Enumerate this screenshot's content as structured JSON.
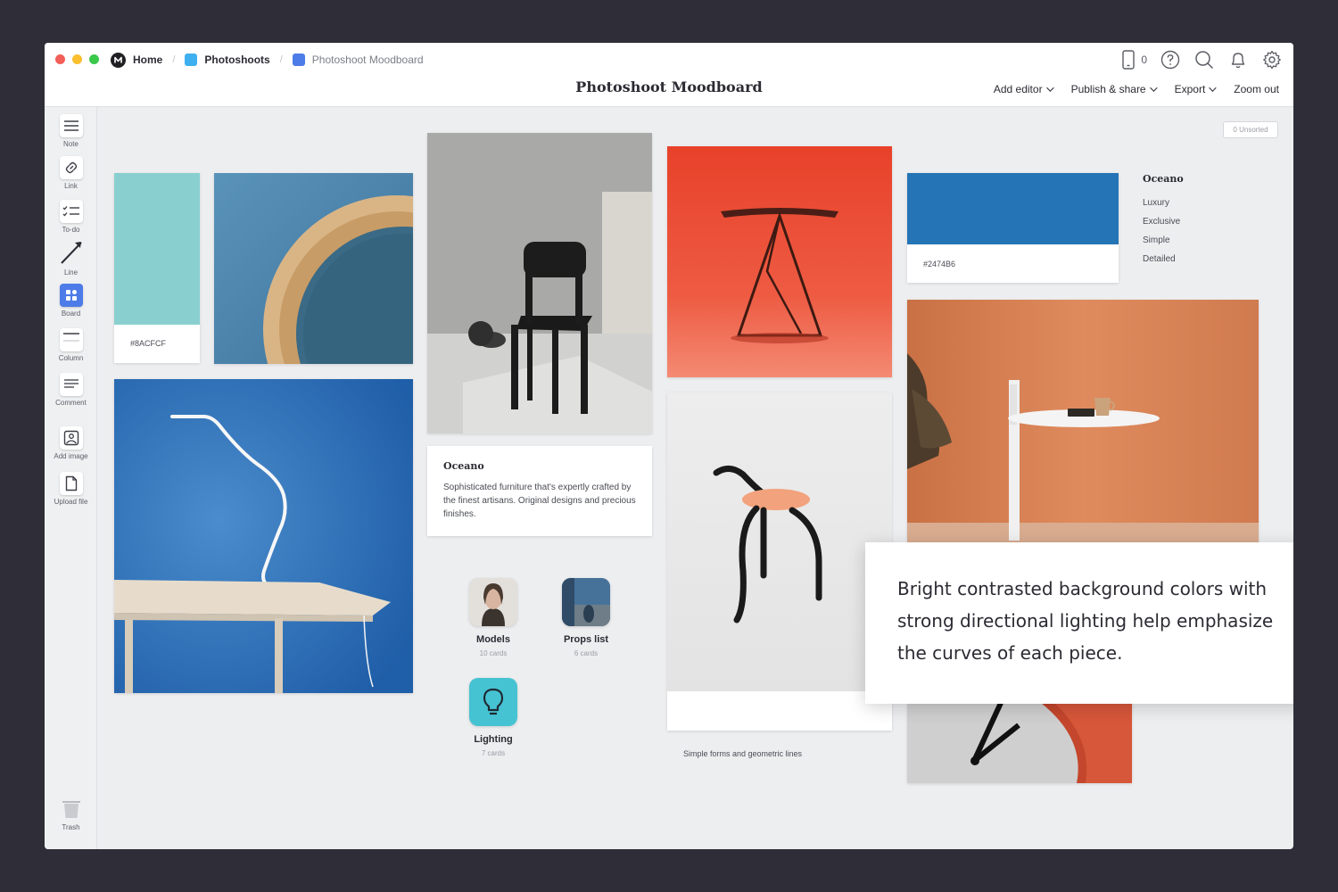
{
  "breadcrumbs": [
    {
      "label": "Home",
      "icon": "milanote-logo-icon"
    },
    {
      "label": "Photoshoots",
      "icon": "board-icon",
      "color": "#3fb0ef"
    },
    {
      "label": "Photoshoot Moodboard",
      "icon": "board-icon",
      "color": "#4d7be8"
    }
  ],
  "title": "Photoshoot Moodboard",
  "header": {
    "device_count": "0",
    "menu": [
      {
        "label": "Add editor",
        "has_dropdown": true
      },
      {
        "label": "Publish & share",
        "has_dropdown": true
      },
      {
        "label": "Export",
        "has_dropdown": true
      },
      {
        "label": "Zoom out",
        "has_dropdown": false
      }
    ]
  },
  "sidebar": {
    "tools": [
      {
        "label": "Note",
        "icon": "note-icon"
      },
      {
        "label": "Link",
        "icon": "link-icon"
      },
      {
        "label": "To-do",
        "icon": "todo-icon"
      },
      {
        "label": "Line",
        "icon": "line-icon"
      },
      {
        "label": "Board",
        "icon": "board-icon"
      },
      {
        "label": "Column",
        "icon": "column-icon"
      },
      {
        "label": "Comment",
        "icon": "comment-icon"
      },
      {
        "label": "Add image",
        "icon": "image-icon"
      },
      {
        "label": "Upload file",
        "icon": "file-icon"
      }
    ],
    "trash_label": "Trash"
  },
  "canvas": {
    "unsorted_label": "0 Unsorted",
    "swatch_teal": {
      "hex": "#8ACFCF",
      "color": "#8acfcf"
    },
    "swatch_blue": {
      "hex": "#2474B6",
      "color": "#2474b6"
    },
    "note_oceano": {
      "title": "Oceano",
      "body": "Sophisticated furniture that's expertly crafted by the finest artisans. Original designs and precious finishes."
    },
    "list_oceano": {
      "title": "Oceano",
      "items": [
        "Luxury",
        "Exclusive",
        "Simple",
        "Detailed"
      ]
    },
    "chair_caption": "Simple forms and geometric lines",
    "sub_boards": [
      {
        "label": "Models",
        "count": "10 cards"
      },
      {
        "label": "Props list",
        "count": "6 cards"
      },
      {
        "label": "Lighting",
        "count": "7 cards",
        "color": "#46c3d2"
      }
    ],
    "callout": "Bright contrasted background colors with strong directional lighting help emphasize the curves of each piece."
  }
}
